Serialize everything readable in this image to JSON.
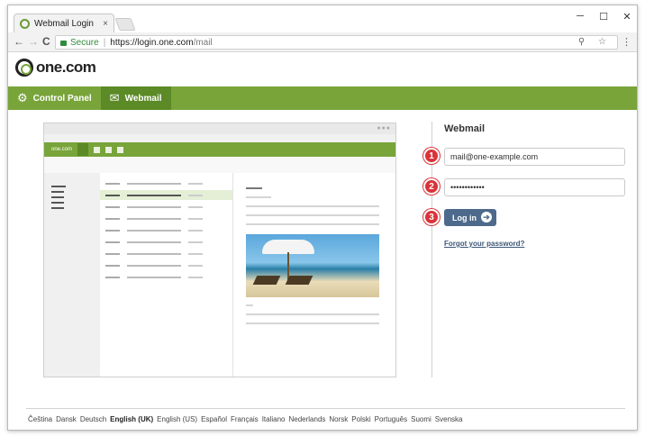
{
  "browser": {
    "tab_title": "Webmail Login",
    "tab_close": "×",
    "minimize": "─",
    "maximize": "☐",
    "close": "✕",
    "back": "←",
    "forward": "→",
    "reload": "C",
    "secure_label": "Secure",
    "separator": "|",
    "url_host": "https://login.one.com",
    "url_path": "/mail",
    "omni_icons": "⚲ ☆",
    "menu": "⋮"
  },
  "brand": {
    "logo_text": "one.com"
  },
  "nav": [
    {
      "label": "Control Panel",
      "icon": "⚙",
      "active": false
    },
    {
      "label": "Webmail",
      "icon": "✉",
      "active": true
    }
  ],
  "mock_logo": "one.com",
  "login": {
    "title": "Webmail",
    "email_value": "mail@one-example.com",
    "password_value": "••••••••••••",
    "login_label": "Log in",
    "login_arrow": "➔",
    "forgot_label": "Forgot your password?",
    "steps": [
      "1",
      "2",
      "3"
    ]
  },
  "languages": [
    {
      "label": "Čeština",
      "selected": false
    },
    {
      "label": "Dansk",
      "selected": false
    },
    {
      "label": "Deutsch",
      "selected": false
    },
    {
      "label": "English (UK)",
      "selected": true
    },
    {
      "label": "English (US)",
      "selected": false
    },
    {
      "label": "Español",
      "selected": false
    },
    {
      "label": "Français",
      "selected": false
    },
    {
      "label": "Italiano",
      "selected": false
    },
    {
      "label": "Nederlands",
      "selected": false
    },
    {
      "label": "Norsk",
      "selected": false
    },
    {
      "label": "Polski",
      "selected": false
    },
    {
      "label": "Português",
      "selected": false
    },
    {
      "label": "Suomi",
      "selected": false
    },
    {
      "label": "Svenska",
      "selected": false
    }
  ],
  "colors": {
    "brand_green": "#78a43a",
    "brand_green_dark": "#5b8a26",
    "button_blue": "#4d6a8c",
    "badge_red": "#d9333a"
  }
}
